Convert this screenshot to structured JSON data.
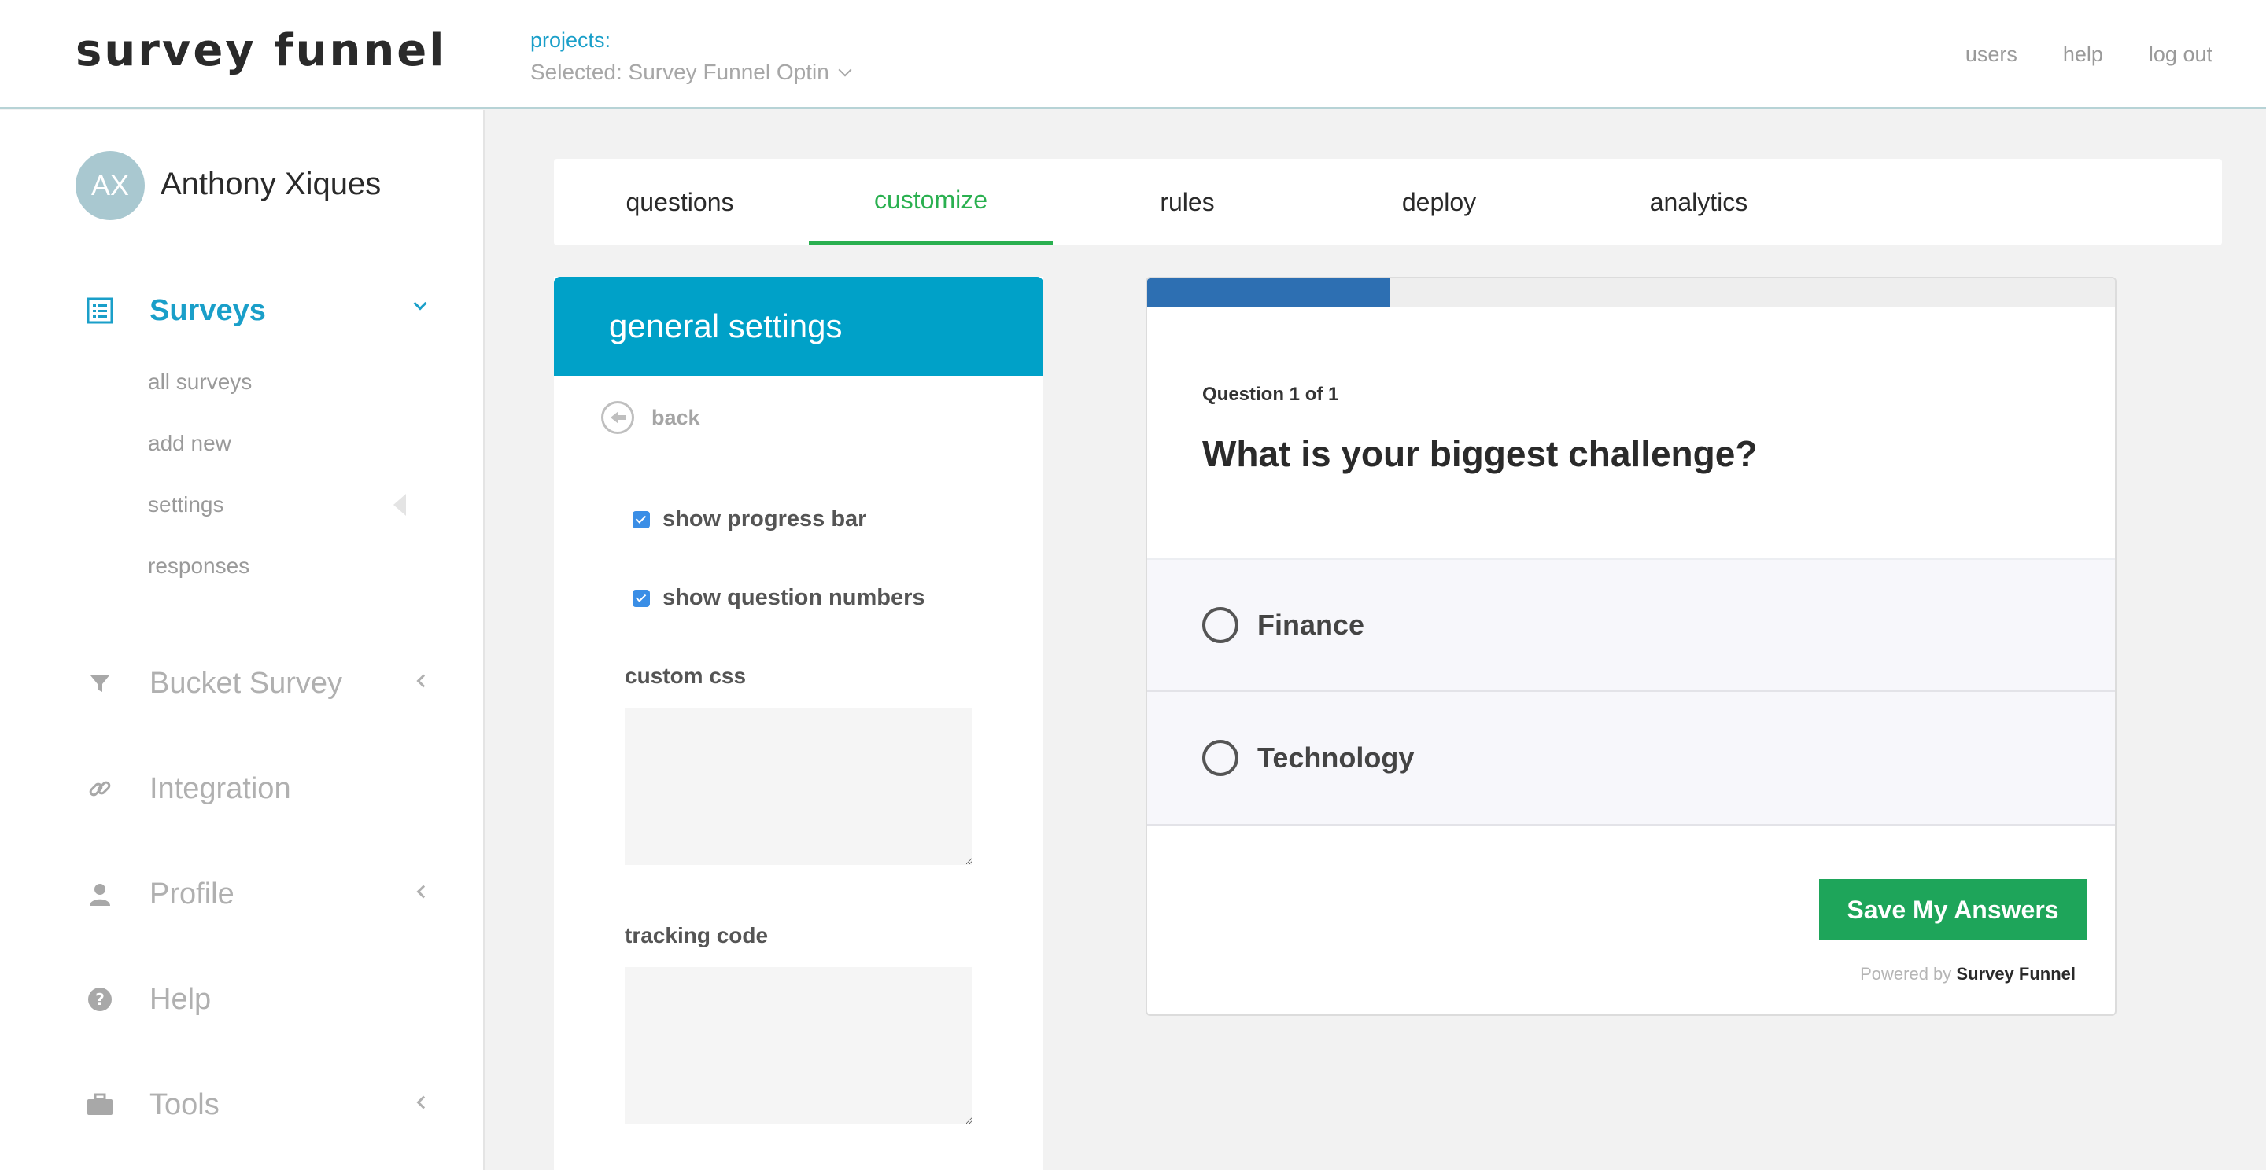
{
  "header": {
    "logo": "survey funnel",
    "projects_label": "projects:",
    "projects_selected": "Selected: Survey Funnel Optin",
    "nav": [
      "users",
      "help",
      "log out"
    ]
  },
  "sidebar": {
    "avatar_initials": "AX",
    "user_name": "Anthony Xiques",
    "items": [
      {
        "label": "Surveys",
        "icon": "survey-list-icon",
        "active": true
      },
      {
        "label": "Bucket Survey",
        "icon": "funnel-icon"
      },
      {
        "label": "Integration",
        "icon": "link-icon"
      },
      {
        "label": "Profile",
        "icon": "user-icon"
      },
      {
        "label": "Help",
        "icon": "question-circle-icon"
      },
      {
        "label": "Tools",
        "icon": "briefcase-icon"
      }
    ],
    "subitems": [
      "all surveys",
      "add new",
      "settings",
      "responses"
    ]
  },
  "tabs": [
    "questions",
    "customize",
    "rules",
    "deploy",
    "analytics"
  ],
  "active_tab": "customize",
  "settings": {
    "title": "general settings",
    "back": "back",
    "show_progress_bar": "show progress bar",
    "show_question_numbers": "show question numbers",
    "custom_css_label": "custom css",
    "tracking_code_label": "tracking code"
  },
  "preview": {
    "progress_fraction": 0.25,
    "question_number": "Question 1 of 1",
    "question_title": "What is your biggest challenge?",
    "options": [
      "Finance",
      "Technology"
    ],
    "save_label": "Save My Answers",
    "powered_prefix": "Powered by",
    "powered_brand": "Survey Funnel"
  },
  "colors": {
    "accent": "#1a9fc9",
    "green": "#2ab050",
    "settings_header": "#00a1c8",
    "progress": "#2d6fb2",
    "save_button": "#1ea55a"
  }
}
